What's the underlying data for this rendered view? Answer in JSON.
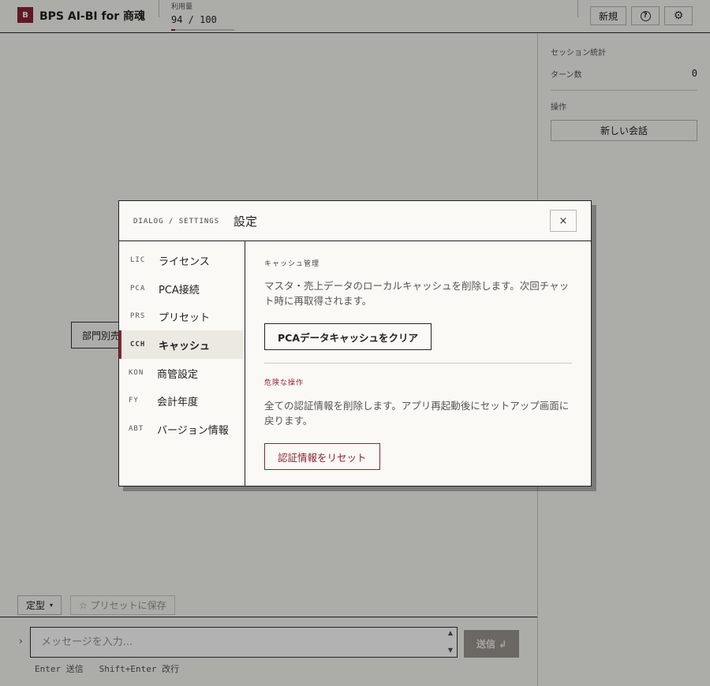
{
  "app": {
    "brand_mark": "B",
    "title": "BPS AI-BI for 商魂",
    "usage_label": "利用量",
    "usage_value": "94 / 100",
    "usage_fraction": 0.06,
    "new_label": "新規",
    "help_glyph": "?",
    "settings_glyph": "⚙"
  },
  "sidebar": {
    "stats_heading": "セッション統計",
    "turns_label": "ターン数",
    "turns_value": "0",
    "ops_heading": "操作",
    "new_chat_label": "新しい会話"
  },
  "chip": {
    "label": "部門別売"
  },
  "composer": {
    "template_label": "定型",
    "template_caret": "▾",
    "save_preset_label": "☆ プリセットに保存",
    "prompt_mark": "›",
    "placeholder": "メッセージを入力...",
    "send_label": "送信",
    "send_glyph": "↲",
    "hint": "Enter 送信   Shift+Enter 改行"
  },
  "dialog": {
    "crumb": "DIALOG / SETTINGS",
    "title": "設定",
    "close_glyph": "×",
    "nav": [
      {
        "code": "LIC",
        "label": "ライセンス"
      },
      {
        "code": "PCA",
        "label": "PCA接続"
      },
      {
        "code": "PRS",
        "label": "プリセット"
      },
      {
        "code": "CCH",
        "label": "キャッシュ"
      },
      {
        "code": "KON",
        "label": "商管設定"
      },
      {
        "code": "FY",
        "label": "会計年度"
      },
      {
        "code": "ABT",
        "label": "バージョン情報"
      }
    ],
    "active_nav": "CCH",
    "cache": {
      "heading": "キャッシュ管理",
      "description": "マスタ・売上データのローカルキャッシュを削除します。次回チャット時に再取得されます。",
      "clear_button": "PCAデータキャッシュをクリア"
    },
    "danger": {
      "heading": "危険な操作",
      "description": "全ての認証情報を削除します。アプリ再起動後にセットアップ画面に戻ります。",
      "reset_button": "認証情報をリセット"
    }
  },
  "colors": {
    "accent": "#8b2332",
    "background": "#f7f6f2",
    "dialog_bg": "#faf9f5",
    "send_disabled": "#9a968f"
  }
}
